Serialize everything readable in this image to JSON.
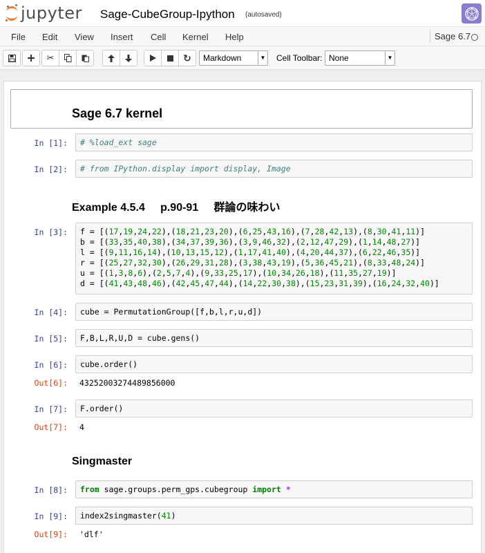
{
  "header": {
    "logo_text": "jupyter",
    "notebook_title": "Sage-CubeGroup-Ipython",
    "autosave_status": "(autosaved)"
  },
  "menubar": {
    "items": [
      "File",
      "Edit",
      "View",
      "Insert",
      "Cell",
      "Kernel",
      "Help"
    ],
    "kernel_name": "Sage 6.7"
  },
  "toolbar": {
    "cell_type": "Markdown",
    "cell_toolbar_label": "Cell Toolbar:",
    "cell_toolbar_value": "None"
  },
  "cells": {
    "h_kernel": "Sage 6.7 kernel",
    "c1": {
      "prompt": "In [1]:",
      "code": "# %load_ext sage"
    },
    "c2": {
      "prompt": "In [2]:",
      "code": "# from IPython.display import display, Image"
    },
    "h_example": "Example 4.5.4     p.90-91     群論の味わい",
    "c3": {
      "prompt": "In [3]:",
      "lines": [
        {
          "var": "f",
          "rest": "[(17,19,24,22),(18,21,23,20),(6,25,43,16),(7,28,42,13),(8,30,41,11)]"
        },
        {
          "var": "b",
          "rest": "[(33,35,40,38),(34,37,39,36),(3,9,46,32),(2,12,47,29),(1,14,48,27)]"
        },
        {
          "var": "l",
          "rest": "[(9,11,16,14),(10,13,15,12),(1,17,41,40),(4,20,44,37),(6,22,46,35)]"
        },
        {
          "var": "r",
          "rest": "[(25,27,32,30),(26,29,31,28),(3,38,43,19),(5,36,45,21),(8,33,48,24)]"
        },
        {
          "var": "u",
          "rest": "[(1,3,8,6),(2,5,7,4),(9,33,25,17),(10,34,26,18),(11,35,27,19)]"
        },
        {
          "var": "d",
          "rest": "[(41,43,48,46),(42,45,47,44),(14,22,30,38),(15,23,31,39),(16,24,32,40)]"
        }
      ]
    },
    "c4": {
      "prompt": "In [4]:",
      "code": "cube = PermutationGroup([f,b,l,r,u,d])"
    },
    "c5": {
      "prompt": "In [5]:",
      "code": "F,B,L,R,U,D = cube.gens()"
    },
    "c6": {
      "prompt": "In [6]:",
      "code": "cube.order()",
      "out_prompt": "Out[6]:",
      "output": "43252003274489856000"
    },
    "c7": {
      "prompt": "In [7]:",
      "code": "F.order()",
      "out_prompt": "Out[7]:",
      "output": "4"
    },
    "h_singmaster": "Singmaster",
    "c8": {
      "prompt": "In [8]:",
      "kw_from": "from",
      "module": " sage.groups.perm_gps.cubegroup ",
      "kw_import": "import",
      "star": " *"
    },
    "c9": {
      "prompt": "In [9]:",
      "func": "index2singmaster(",
      "arg": "41",
      "close": ")",
      "out_prompt": "Out[9]:",
      "output": "'dlf'"
    }
  }
}
